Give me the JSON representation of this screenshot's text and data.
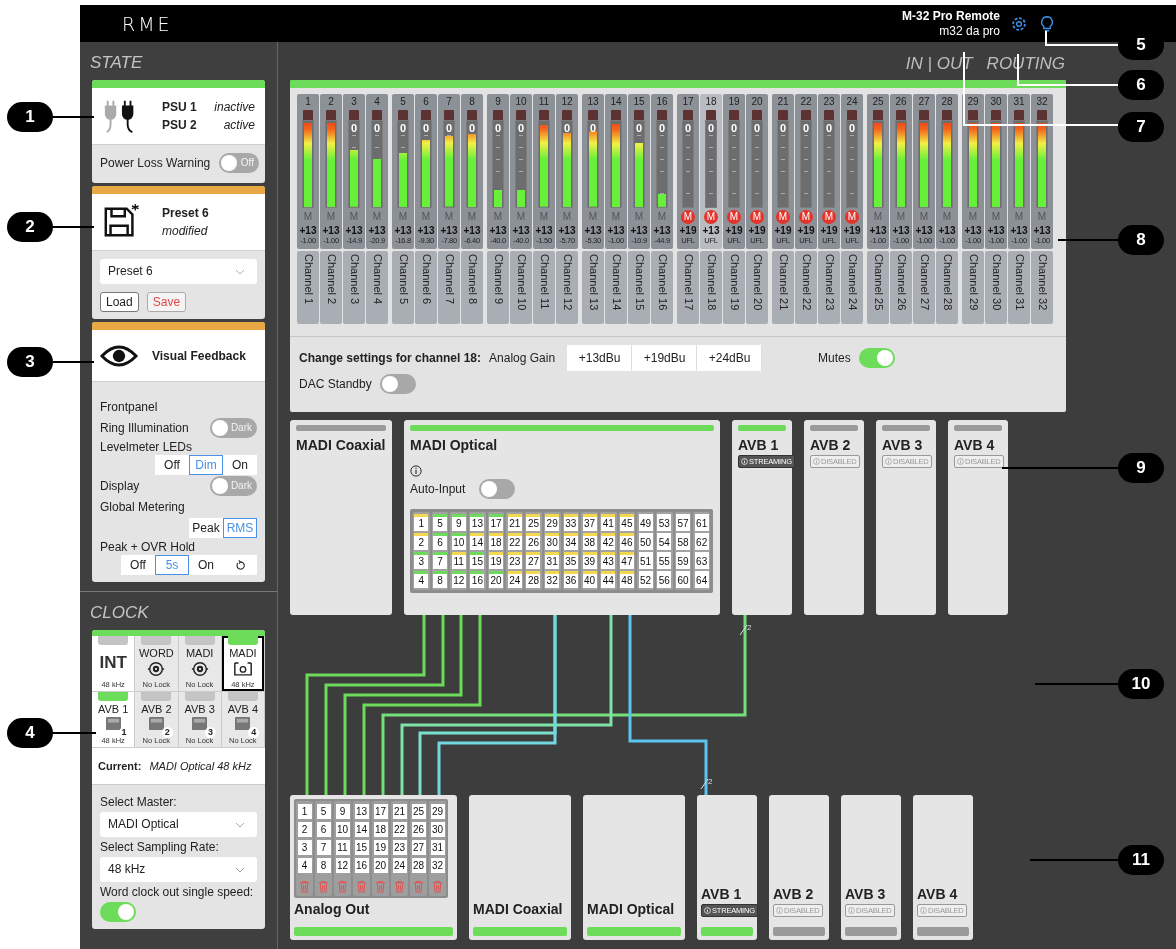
{
  "header": {
    "logo": "RME",
    "device_name": "M-32 Pro Remote",
    "device_subtitle": "m32 da pro"
  },
  "state": {
    "title": "STATE",
    "power": {
      "color": "#6ddc5a",
      "psus": [
        {
          "name": "PSU 1",
          "state": "inactive"
        },
        {
          "name": "PSU 2",
          "state": "active"
        }
      ],
      "warning": {
        "label": "Power Loss Warning",
        "on": false,
        "text": "Off"
      }
    },
    "preset": {
      "color": "#e8a845",
      "name": "Preset 6",
      "state": "modified",
      "select": "Preset 6",
      "buttons": [
        {
          "label": "Load",
          "kind": "load"
        },
        {
          "label": "Save",
          "kind": "save"
        }
      ]
    },
    "visual": {
      "color": "#e8a845",
      "title": "Visual Feedback",
      "rows": [
        {
          "kind": "heading",
          "label": "Frontpanel"
        },
        {
          "kind": "toggle",
          "label": "Ring Illumination",
          "on": false,
          "text": "Dark"
        },
        {
          "kind": "segmented",
          "label": "Levelmeter LEDs",
          "options": [
            {
              "label": "Off",
              "selected": false
            },
            {
              "label": "Dim",
              "selected": true
            },
            {
              "label": "On",
              "selected": false
            }
          ]
        },
        {
          "kind": "toggle",
          "label": "Display",
          "on": false,
          "text": "Dark"
        },
        {
          "kind": "heading",
          "label": "Global Metering"
        },
        {
          "kind": "segmented",
          "options": [
            {
              "label": "Peak",
              "selected": false
            },
            {
              "label": "RMS",
              "selected": true
            }
          ]
        },
        {
          "kind": "segmented",
          "label": "Peak + OVR Hold",
          "options": [
            {
              "label": "Off",
              "selected": false
            },
            {
              "label": "5s",
              "selected": true
            },
            {
              "label": "On",
              "selected": false
            },
            {
              "kind": "reset",
              "selected": false
            }
          ]
        }
      ]
    }
  },
  "clock": {
    "title": "CLOCK",
    "color": "#6ddc5a",
    "sources": [
      {
        "label": "INT",
        "kind": "int",
        "rate": "48 kHz",
        "locked": false,
        "available": true,
        "selected": false
      },
      {
        "label": "WORD",
        "kind": "bnc",
        "rate": "No Lock",
        "locked": false,
        "available": false,
        "selected": false
      },
      {
        "label": "MADI",
        "kind": "bnc",
        "rate": "No Lock",
        "locked": false,
        "available": false,
        "selected": false
      },
      {
        "label": "MADI",
        "kind": "optical",
        "rate": "48 kHz",
        "locked": true,
        "available": true,
        "selected": true
      },
      {
        "label": "AVB 1",
        "kind": "network",
        "number": "1",
        "rate": "48 kHz",
        "locked": true,
        "available": true,
        "selected": false
      },
      {
        "label": "AVB 2",
        "kind": "network",
        "number": "2",
        "rate": "No Lock",
        "locked": false,
        "available": false,
        "selected": false
      },
      {
        "label": "AVB 3",
        "kind": "network",
        "number": "3",
        "rate": "No Lock",
        "locked": false,
        "available": false,
        "selected": false
      },
      {
        "label": "AVB 4",
        "kind": "network",
        "number": "4",
        "rate": "No Lock",
        "locked": false,
        "available": false,
        "selected": false
      }
    ],
    "current_label": "Current:",
    "current_value": "MADI Optical 48 kHz",
    "fields": [
      {
        "label": "Select Master:",
        "value": "MADI Optical"
      },
      {
        "label": "Select Sampling Rate:",
        "value": "48 kHz"
      }
    ],
    "single_speed": {
      "label": "Word clock out single speed:",
      "on": true
    }
  },
  "routing": {
    "title": "IN | OUT",
    "subtitle": "ROUTING",
    "channels": [
      {
        "number": "1",
        "level": 0.98,
        "mute_label": "M",
        "muted": false,
        "gain": "+13",
        "reading": "-1.00",
        "name": "Channel 1",
        "selected": false
      },
      {
        "number": "2",
        "level": 0.98,
        "mute_label": "M",
        "muted": false,
        "gain": "+13",
        "reading": "-1.00",
        "name": "Channel 2",
        "selected": false
      },
      {
        "number": "3",
        "level": 0.66,
        "scale": "0",
        "mute_label": "M",
        "muted": false,
        "gain": "+13",
        "reading": "-14.9",
        "name": "Channel 3",
        "selected": false
      },
      {
        "number": "4",
        "level": 0.56,
        "scale": "0",
        "mute_label": "M",
        "muted": false,
        "gain": "+13",
        "reading": "-20.9",
        "name": "Channel 4",
        "selected": false
      },
      {
        "number": "5",
        "level": 0.63,
        "scale": "0",
        "mute_label": "M",
        "muted": false,
        "gain": "+13",
        "reading": "-16.8",
        "name": "Channel 5",
        "selected": false
      },
      {
        "number": "6",
        "level": 0.78,
        "scale": "0",
        "mute_label": "M",
        "muted": false,
        "gain": "+13",
        "reading": "-9.30",
        "name": "Channel 6",
        "selected": false
      },
      {
        "number": "7",
        "level": 0.82,
        "scale": "0",
        "mute_label": "M",
        "muted": false,
        "gain": "+13",
        "reading": "-7.80",
        "name": "Channel 7",
        "selected": false
      },
      {
        "number": "8",
        "level": 0.85,
        "scale": "0",
        "mute_label": "M",
        "muted": false,
        "gain": "+13",
        "reading": "-6.40",
        "name": "Channel 8",
        "selected": false
      },
      {
        "number": "9",
        "level": 0.2,
        "scale": "0",
        "mute_label": "M",
        "muted": false,
        "gain": "+13",
        "reading": "-40.0",
        "name": "Channel 9",
        "selected": false
      },
      {
        "number": "10",
        "level": 0.2,
        "scale": "0",
        "mute_label": "M",
        "muted": false,
        "gain": "+13",
        "reading": "-40.0",
        "name": "Channel 10",
        "selected": false
      },
      {
        "number": "11",
        "level": 0.95,
        "mute_label": "M",
        "muted": false,
        "gain": "+13",
        "reading": "-1.50",
        "name": "Channel 11",
        "selected": false
      },
      {
        "number": "12",
        "level": 0.86,
        "scale": "0",
        "mute_label": "M",
        "muted": false,
        "gain": "+13",
        "reading": "-5.70",
        "name": "Channel 12",
        "selected": false
      },
      {
        "number": "13",
        "level": 0.88,
        "scale": "0",
        "mute_label": "M",
        "muted": false,
        "gain": "+13",
        "reading": "-5.30",
        "name": "Channel 13",
        "selected": false
      },
      {
        "number": "14",
        "level": 0.97,
        "mute_label": "M",
        "muted": false,
        "gain": "+13",
        "reading": "-1.00",
        "name": "Channel 14",
        "selected": false
      },
      {
        "number": "15",
        "level": 0.75,
        "scale": "0",
        "mute_label": "M",
        "muted": false,
        "gain": "+13",
        "reading": "-10.9",
        "name": "Channel 15",
        "selected": false
      },
      {
        "number": "16",
        "level": 0.15,
        "scale": "0",
        "mute_label": "M",
        "muted": false,
        "gain": "+13",
        "reading": "-44.9",
        "name": "Channel 16",
        "selected": false
      },
      {
        "number": "17",
        "scale": "0",
        "mute_label": "M",
        "muted": true,
        "gain": "+19",
        "reading": "UFL",
        "name": "Channel 17",
        "selected": false
      },
      {
        "number": "18",
        "scale": "0",
        "mute_label": "M",
        "muted": true,
        "gain": "+13",
        "reading": "UFL",
        "name": "Channel 18",
        "selected": true
      },
      {
        "number": "19",
        "scale": "0",
        "mute_label": "M",
        "muted": true,
        "gain": "+19",
        "reading": "UFL",
        "name": "Channel 19",
        "selected": false
      },
      {
        "number": "20",
        "scale": "0",
        "mute_label": "M",
        "muted": true,
        "gain": "+19",
        "reading": "UFL",
        "name": "Channel 20",
        "selected": false
      },
      {
        "number": "21",
        "scale": "0",
        "mute_label": "M",
        "muted": true,
        "gain": "+19",
        "reading": "UFL",
        "name": "Channel 21",
        "selected": false
      },
      {
        "number": "22",
        "scale": "0",
        "mute_label": "M",
        "muted": true,
        "gain": "+19",
        "reading": "UFL",
        "name": "Channel 22",
        "selected": false
      },
      {
        "number": "23",
        "scale": "0",
        "mute_label": "M",
        "muted": true,
        "gain": "+19",
        "reading": "UFL",
        "name": "Channel 23",
        "selected": false
      },
      {
        "number": "24",
        "scale": "0",
        "mute_label": "M",
        "muted": true,
        "gain": "+19",
        "reading": "UFL",
        "name": "Channel 24",
        "selected": false
      },
      {
        "number": "25",
        "level": 0.98,
        "mute_label": "M",
        "muted": false,
        "gain": "+13",
        "reading": "-1.00",
        "name": "Channel 25",
        "selected": false
      },
      {
        "number": "26",
        "level": 0.98,
        "mute_label": "M",
        "muted": false,
        "gain": "+13",
        "reading": "-1.00",
        "name": "Channel 26",
        "selected": false
      },
      {
        "number": "27",
        "level": 0.98,
        "mute_label": "M",
        "muted": false,
        "gain": "+13",
        "reading": "-1.00",
        "name": "Channel 27",
        "selected": false
      },
      {
        "number": "28",
        "level": 0.98,
        "mute_label": "M",
        "muted": false,
        "gain": "+13",
        "reading": "-1.00",
        "name": "Channel 28",
        "selected": false
      },
      {
        "number": "29",
        "level": 0.98,
        "mute_label": "M",
        "muted": false,
        "gain": "+13",
        "reading": "-1.00",
        "name": "Channel 29",
        "selected": false
      },
      {
        "number": "30",
        "level": 0.98,
        "mute_label": "M",
        "muted": false,
        "gain": "+13",
        "reading": "-1.00",
        "name": "Channel 30",
        "selected": false
      },
      {
        "number": "31",
        "level": 0.98,
        "mute_label": "M",
        "muted": false,
        "gain": "+13",
        "reading": "-1.00",
        "name": "Channel 31",
        "selected": false
      },
      {
        "number": "32",
        "level": 0.98,
        "mute_label": "M",
        "muted": false,
        "gain": "+13",
        "reading": "-1.00",
        "name": "Channel 32",
        "selected": false
      }
    ],
    "settings": {
      "label": "Change settings for channel 18:",
      "gain_label": "Analog Gain",
      "gains": [
        {
          "label": "+13dBu",
          "selected": false
        },
        {
          "label": "+19dBu",
          "selected": false
        },
        {
          "label": "+24dBu",
          "selected": false
        }
      ],
      "mutes": {
        "label": "Mutes",
        "on": true
      },
      "dac": {
        "label": "DAC Standby",
        "on": false
      }
    },
    "inputs": [
      {
        "name": "MADI Coaxial",
        "kind": "madi",
        "active": false
      },
      {
        "name": "MADI Optical",
        "kind": "madi_grid",
        "active": true,
        "auto_input": {
          "label": "Auto-Input",
          "on": false
        },
        "cells": [
          {
            "label": "1",
            "color": "#f2d94e"
          },
          {
            "label": "2",
            "color": "#f2d94e"
          },
          {
            "label": "3",
            "color": "#6ddc5a"
          },
          {
            "label": "4",
            "color": "#6ddc5a"
          },
          {
            "label": "5",
            "color": "#6ddc5a"
          },
          {
            "label": "6",
            "color": "#6ddc5a"
          },
          {
            "label": "7",
            "color": "#6ddc5a"
          },
          {
            "label": "8",
            "color": "#6ddc5a"
          },
          {
            "label": "9",
            "color": "#6ddc5a"
          },
          {
            "label": "10",
            "color": "#6ddc5a"
          },
          {
            "label": "11",
            "color": "#f2d94e"
          },
          {
            "label": "12",
            "color": "#6ddc5a"
          },
          {
            "label": "13",
            "color": "#6ddc5a"
          },
          {
            "label": "14",
            "color": "#f2d94e"
          },
          {
            "label": "15",
            "color": "#6ddc5a"
          },
          {
            "label": "16",
            "color": "#6ddc5a"
          },
          {
            "label": "17",
            "color": "#6ddc5a"
          },
          {
            "label": "18",
            "color": "#f2d94e"
          },
          {
            "label": "19",
            "color": "#f2d94e"
          },
          {
            "label": "20",
            "color": "#6ddc5a"
          },
          {
            "label": "21",
            "color": "#f2d94e"
          },
          {
            "label": "22",
            "color": "#f2d94e"
          },
          {
            "label": "23",
            "color": "#f2d94e"
          },
          {
            "label": "24",
            "color": "#f2d94e"
          },
          {
            "label": "25",
            "color": "#f2d94e"
          },
          {
            "label": "26",
            "color": "#f2d94e"
          },
          {
            "label": "27",
            "color": "#f2d94e"
          },
          {
            "label": "28",
            "color": "#f2d94e"
          },
          {
            "label": "29",
            "color": "#f2d94e"
          },
          {
            "label": "30",
            "color": "#f2d94e"
          },
          {
            "label": "31",
            "color": "#f2d94e"
          },
          {
            "label": "32",
            "color": "#f2d94e"
          },
          {
            "label": "33",
            "color": "#f2d94e"
          },
          {
            "label": "34",
            "color": "#f2d94e"
          },
          {
            "label": "35",
            "color": "#f2d94e"
          },
          {
            "label": "36",
            "color": "#f2d94e"
          },
          {
            "label": "37",
            "color": "#f2d94e"
          },
          {
            "label": "38",
            "color": "#f2d94e"
          },
          {
            "label": "39",
            "color": "#f2d94e"
          },
          {
            "label": "40",
            "color": "#f2d94e"
          },
          {
            "label": "41",
            "color": "#f2d94e"
          },
          {
            "label": "42",
            "color": "#f2d94e"
          },
          {
            "label": "43",
            "color": "#f2d94e"
          },
          {
            "label": "44",
            "color": "#f2d94e"
          },
          {
            "label": "45",
            "color": "#f2d94e"
          },
          {
            "label": "46",
            "color": "#f2d94e"
          },
          {
            "label": "47",
            "color": "#f2d94e"
          },
          {
            "label": "48",
            "color": "#f2d94e"
          },
          {
            "label": "49"
          },
          {
            "label": "50"
          },
          {
            "label": "51"
          },
          {
            "label": "52"
          },
          {
            "label": "53"
          },
          {
            "label": "54"
          },
          {
            "label": "55"
          },
          {
            "label": "56"
          },
          {
            "label": "57"
          },
          {
            "label": "58"
          },
          {
            "label": "59"
          },
          {
            "label": "60"
          },
          {
            "label": "61"
          },
          {
            "label": "62"
          },
          {
            "label": "63"
          },
          {
            "label": "64"
          }
        ]
      },
      {
        "name": "AVB 1",
        "kind": "avb",
        "active": true,
        "badge": {
          "text": "STREAMING",
          "streaming": true
        }
      },
      {
        "name": "AVB 2",
        "kind": "avb",
        "active": false,
        "badge": {
          "text": "DISABLED",
          "streaming": false
        }
      },
      {
        "name": "AVB 3",
        "kind": "avb",
        "active": false,
        "badge": {
          "text": "DISABLED",
          "streaming": false
        }
      },
      {
        "name": "AVB 4",
        "kind": "avb",
        "active": false,
        "badge": {
          "text": "DISABLED",
          "streaming": false
        }
      }
    ],
    "bus_marks": [
      {
        "label": "2"
      },
      {
        "label": "2"
      }
    ],
    "outputs": [
      {
        "name": "Analog Out",
        "kind": "analog",
        "active": true,
        "columns": [
          [
            "1",
            "2",
            "3",
            "4"
          ],
          [
            "5",
            "6",
            "7",
            "8"
          ],
          [
            "9",
            "10",
            "11",
            "12"
          ],
          [
            "13",
            "14",
            "15",
            "16"
          ],
          [
            "17",
            "18",
            "19",
            "20"
          ],
          [
            "21",
            "22",
            "23",
            "24"
          ],
          [
            "25",
            "26",
            "27",
            "28"
          ],
          [
            "29",
            "30",
            "31",
            "32"
          ]
        ]
      },
      {
        "name": "MADI Coaxial",
        "kind": "madi",
        "active": true
      },
      {
        "name": "MADI Optical",
        "kind": "madi",
        "active": true
      },
      {
        "name": "AVB 1",
        "kind": "avb",
        "active": true,
        "badge": {
          "text": "STREAMING",
          "streaming": true
        }
      },
      {
        "name": "AVB 2",
        "kind": "avb",
        "active": false,
        "badge": {
          "text": "DISABLED",
          "streaming": false
        }
      },
      {
        "name": "AVB 3",
        "kind": "avb",
        "active": false,
        "badge": {
          "text": "DISABLED",
          "streaming": false
        }
      },
      {
        "name": "AVB 4",
        "kind": "avb",
        "active": false,
        "badge": {
          "text": "DISABLED",
          "streaming": false
        }
      }
    ]
  },
  "callouts": [
    {
      "label": "1"
    },
    {
      "label": "2"
    },
    {
      "label": "3"
    },
    {
      "label": "4"
    },
    {
      "label": "5"
    },
    {
      "label": "6"
    },
    {
      "label": "7"
    },
    {
      "label": "8"
    },
    {
      "label": "9"
    },
    {
      "label": "10"
    },
    {
      "label": "11"
    }
  ]
}
